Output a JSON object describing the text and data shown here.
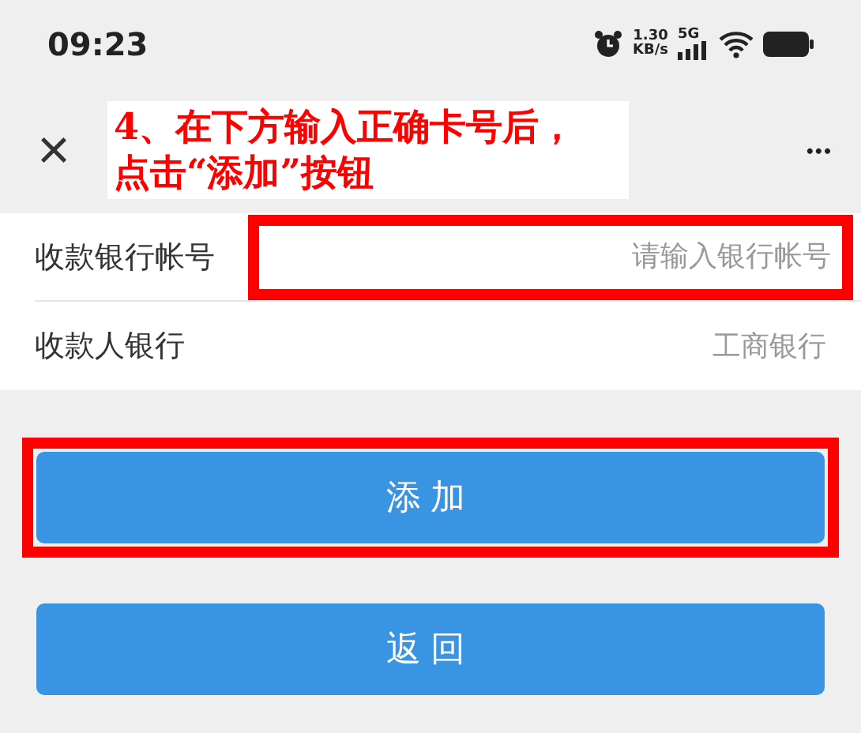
{
  "status_bar": {
    "time": "09:23",
    "speed_value": "1.30",
    "speed_unit": "KB/s",
    "network": "5G"
  },
  "header": {
    "close": "×",
    "more": "•••"
  },
  "annotation": {
    "lines": [
      "4、在下方输入正确卡号后，",
      "点击“添加”按钮"
    ]
  },
  "form": [
    {
      "label": "收款银行帐号",
      "kind": "input",
      "placeholder": "请输入银行帐号",
      "highlighted": true
    },
    {
      "label": "收款人银行",
      "kind": "value",
      "value": "工商银行"
    }
  ],
  "buttons": [
    {
      "label": "添加",
      "highlighted": true
    },
    {
      "label": "返回",
      "highlighted": false
    }
  ]
}
